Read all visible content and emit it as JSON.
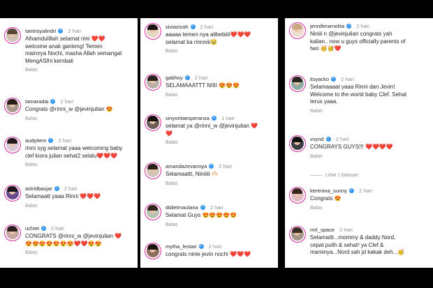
{
  "columns": [
    {
      "comments": [
        {
          "user": "tantrisyalindri",
          "time": "2 hari",
          "text": "Alhamdulillah selamat nini ❤️❤️\nwelcome anak ganteng! Temen\nmainnya Nochi, masha Allah semangat\nMengASIhi kembali",
          "reply": "Balas",
          "avatar_bg": "#cfc1b4",
          "hair": "#5a4636"
        },
        {
          "user": "tamaradai",
          "time": "2 hari",
          "text": "Congrats @rinni_w @jevinjulian 😍",
          "reply": "Balas",
          "avatar_bg": "#a9988e",
          "hair": "#2b1d18"
        },
        {
          "user": "audyitem",
          "time": "2 hari",
          "text": "rinni syg selamat yaaa welcoming baby\nclef kiora julian sehat2 selalu❤️❤️❤️",
          "reply": "Balas",
          "avatar_bg": "#d9c8d8",
          "hair": "#22181b"
        },
        {
          "user": "astridbasjar",
          "time": "2 hari",
          "text": "Selamaatt yaaa Rinni ❤️❤️❤️",
          "reply": "Balas",
          "avatar_bg": "#6d4a8f",
          "hair": "#1d1420"
        },
        {
          "user": "uchiet",
          "time": "2 hari",
          "text": "CONGRATS @rinni_w @jevinjulian ❤️\n😍😍😍😍😍😍😍❤️❤️😍😍",
          "reply": "Balas",
          "avatar_bg": "#c6a7a0",
          "hair": "#2e201c"
        }
      ]
    },
    {
      "comments": [
        {
          "user": "siviazizah",
          "time": "2 hari",
          "text": "aaaaa temen nya alibebiiii❤️❤️❤️\nselamat ka rinnniii🥹",
          "reply": "Balas",
          "avatar_bg": "#e7d6c4",
          "hair": "#1b1512"
        },
        {
          "user": "gabhoy",
          "time": "2 hari",
          "text": "SELAMAAATTT NIIII 😍😍😍",
          "reply": "Balas",
          "avatar_bg": "#b9b1a7",
          "hair": "#2a211d"
        },
        {
          "user": "sinyoritaesperanza",
          "time": "1 hari",
          "text": "selamat ya @rinni_w @jevinjulian ❤️\n❤️",
          "reply": "Balas",
          "avatar_bg": "#6e5d58",
          "hair": "#161010"
        },
        {
          "user": "amandazevannya",
          "time": "2 hari",
          "text": "Selamaattt, Niniiiii 🫶🏻",
          "reply": "Balas",
          "avatar_bg": "#d3c4b8",
          "hair": "#2b201a"
        },
        {
          "user": "didietmaulana",
          "time": "2 hari",
          "text": "Selamat Guys 😍😍😍😍😍",
          "reply": "Balas",
          "avatar_bg": "#b7c3b0",
          "hair": "#33261e"
        },
        {
          "user": "mytha_lestari",
          "time": "2 hari",
          "text": "congrats ninie jevin nochi ❤️❤️❤️",
          "reply": "",
          "avatar_bg": "#8f6e5d",
          "hair": "#1c1410"
        }
      ]
    },
    {
      "comments": [
        {
          "user": "jenniferarnelita",
          "time": "2 hari",
          "text": "Niniii n @jevinjulian congrats yah\nkalian.. now u guys officially parents of\ntwo 🥳🥳❤️",
          "reply": "",
          "avatar_bg": "#efdcd0",
          "hair": "#c9a582"
        },
        {
          "user": "itsyacko",
          "time": "2 hari",
          "text": "Selamaaaat yaaa Rinni dan Jevin!\nWelcome to the world baby Clef. Sehat\nterus yaaa.",
          "reply": "Balas",
          "avatar_bg": "#8fa9a3",
          "hair": "#2a2622"
        },
        {
          "user": "vvynd",
          "time": "2 hari",
          "text": "CONGRAYS GUYS!!! ❤️❤️❤️❤️",
          "reply": "Balas",
          "avatar_bg": "#3c3c44",
          "hair": "#121214"
        },
        {
          "user": "kerenina_sunny",
          "time": "2 hari",
          "text": "Congrats 😍",
          "reply": "Balas",
          "avatar_bg": "#e1b9c0",
          "hair": "#3a241f"
        },
        {
          "user": "mrt_space",
          "time": "2 hari",
          "text": "Selamattt...mommy & daddy Nord,\ncepat pulih & sehat² ya Clef &\nmaminya...Nord sah jd kakak deh...🥳",
          "reply": "",
          "avatar_bg": "#a5968a",
          "hair": "#3b2e24"
        }
      ],
      "view_replies": "Lihat 1 balasan"
    }
  ]
}
